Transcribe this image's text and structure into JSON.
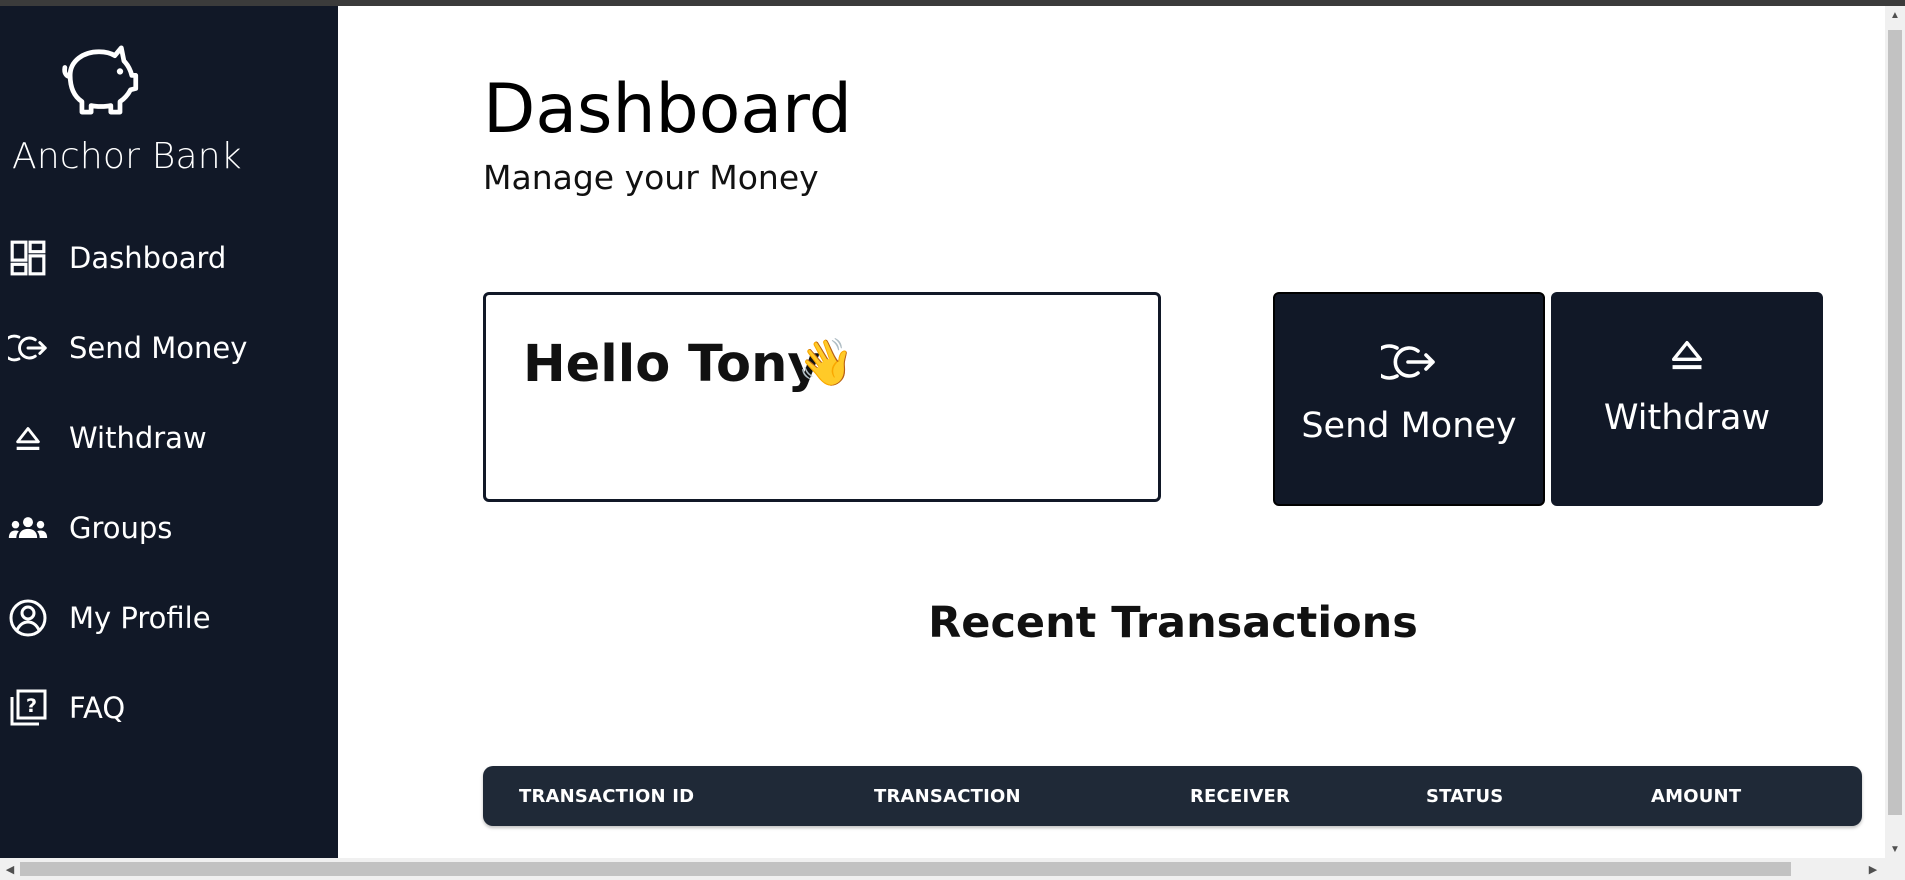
{
  "app": {
    "brand": "Anchor Bank",
    "logo_icon": "piggy-bank-icon"
  },
  "sidebar": {
    "items": [
      {
        "label": "Dashboard",
        "icon": "dashboard-grid-icon"
      },
      {
        "label": "Send Money",
        "icon": "send-money-icon"
      },
      {
        "label": "Withdraw",
        "icon": "withdraw-eject-icon"
      },
      {
        "label": "Groups",
        "icon": "groups-icon"
      },
      {
        "label": "My Profile",
        "icon": "profile-icon"
      },
      {
        "label": "FAQ",
        "icon": "faq-icon"
      }
    ]
  },
  "main": {
    "title": "Dashboard",
    "subtitle": "Manage your Money",
    "greeting": "Hello Tony",
    "greeting_emoji": "👋",
    "actions": {
      "send_label": "Send Money",
      "withdraw_label": "Withdraw"
    },
    "transactions": {
      "title": "Recent Transactions",
      "columns": [
        "TRANSACTION ID",
        "TRANSACTION",
        "RECEIVER",
        "STATUS",
        "AMOUNT"
      ],
      "rows": []
    }
  },
  "colors": {
    "sidebar_bg": "#111827",
    "table_header_bg": "#1f2937",
    "text_on_dark": "#ffffff"
  }
}
